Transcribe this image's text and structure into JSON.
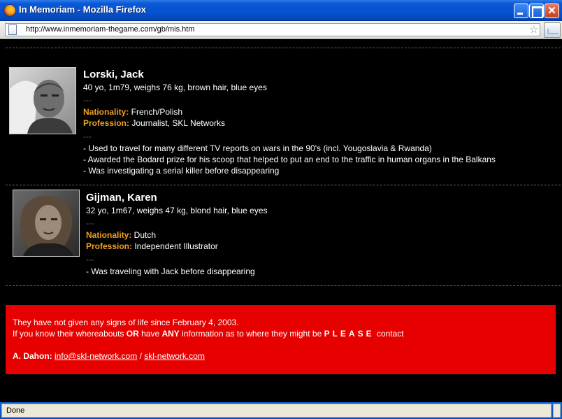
{
  "window": {
    "title": "In Memoriam - Mozilla Firefox",
    "url": "http://www.inmemoriam-thegame.com/gb/mis.htm",
    "close_glyph": "✕"
  },
  "persons": [
    {
      "name": "Lorski, Jack",
      "details": "40 yo, 1m79, weighs 76 kg, brown hair, blue eyes",
      "separator": "---",
      "nationality_label": "Nationality:",
      "nationality": " French/Polish",
      "profession_label": "Profession:",
      "profession": " Journalist, SKL Networks",
      "notes": [
        "- Used to travel for many different TV reports on wars in the 90's (incl. Yougoslavia & Rwanda)",
        "- Awarded the Bodard prize for his scoop that helped to put an end to the traffic in human organs in the Balkans",
        "- Was investigating a serial killer before disappearing"
      ]
    },
    {
      "name": "Gijman, Karen",
      "details": "32 yo, 1m67, weighs 47 kg, blond hair, blue eyes",
      "separator": "---",
      "nationality_label": "Nationality:",
      "nationality": " Dutch",
      "profession_label": "Profession:",
      "profession": " Independent Illustrator",
      "notes": [
        "- Was traveling with Jack before disappearing"
      ]
    }
  ],
  "notice": {
    "line1": "They have not given any signs of life since February 4, 2003.",
    "line2_a": "If you know their whereabouts ",
    "line2_or": "OR",
    "line2_b": " have ",
    "line2_any": "ANY",
    "line2_c": " information as to where they might be ",
    "line2_please": "PLEASE",
    "line2_d": " contact",
    "contact_name": "A. Dahon:",
    "email": "info@skl-network.com",
    "slash": " / ",
    "website": "skl-network.com"
  },
  "status": {
    "text": "Done"
  },
  "colors": {
    "label_orange": "#f0a020",
    "notice_red": "#e60000"
  }
}
